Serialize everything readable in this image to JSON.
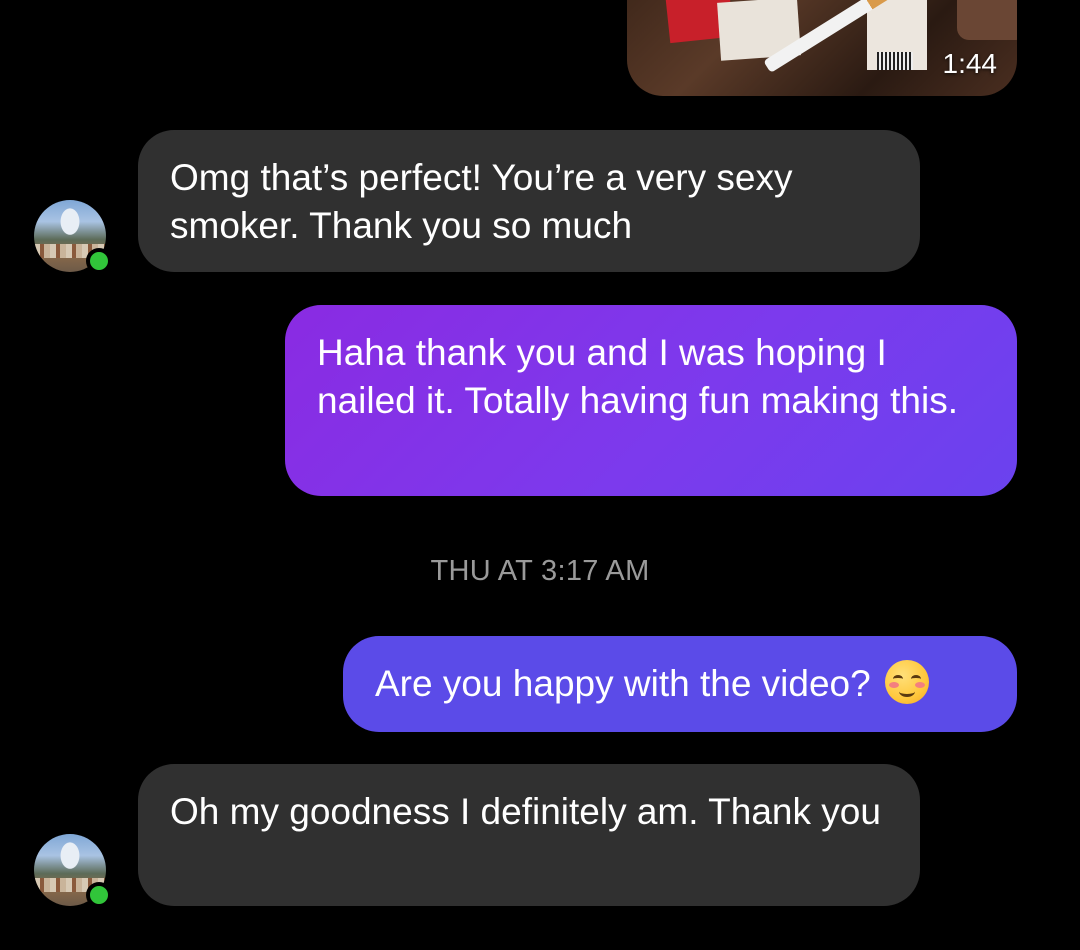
{
  "colors": {
    "background": "#000000",
    "incoming_bubble": "#303030",
    "outgoing_bubble_1": "#7c3aed",
    "outgoing_bubble_2": "#5b4be8",
    "online_dot": "#31c53a",
    "timestamp_text": "#9a9a9a"
  },
  "video": {
    "duration": "1:44"
  },
  "messages": [
    {
      "direction": "incoming",
      "text": "Omg that’s perfect!  You’re a very sexy smoker. Thank you so much"
    },
    {
      "direction": "outgoing",
      "text": "Haha thank you and I was hoping I nailed it. Totally having fun making this."
    },
    {
      "direction": "outgoing",
      "text": "Are you happy with the video?",
      "emoji": "smiling-face-with-smiling-eyes"
    },
    {
      "direction": "incoming",
      "text": "Oh my goodness I definitely am. Thank you"
    }
  ],
  "timestamp": "THU AT 3:17 AM"
}
